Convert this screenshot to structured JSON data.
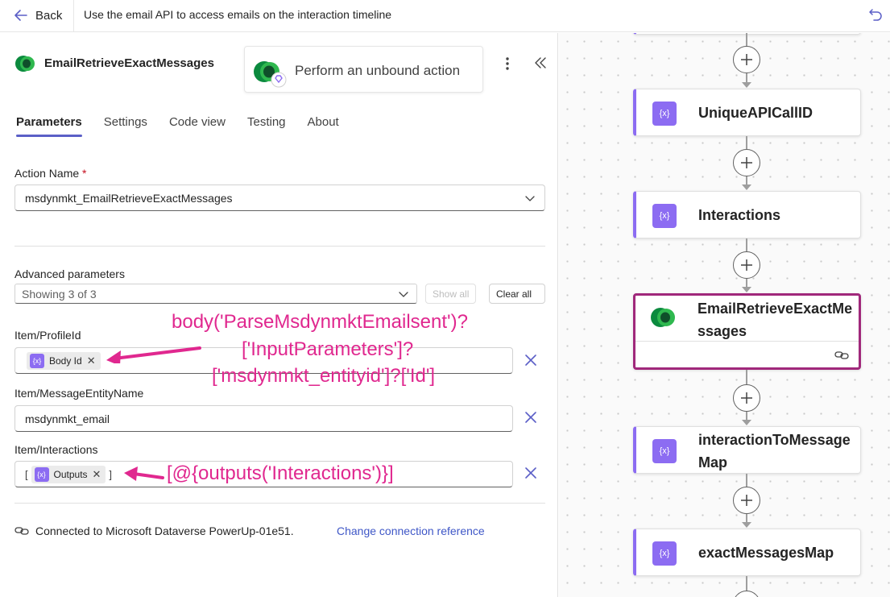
{
  "topbar": {
    "back_label": "Back",
    "title": "Use the email API to access emails on the interaction timeline"
  },
  "panel": {
    "action_title": "EmailRetrieveExactMessages",
    "perform_label": "Perform an unbound action",
    "tabs": [
      {
        "label": "Parameters",
        "active": true
      },
      {
        "label": "Settings",
        "active": false
      },
      {
        "label": "Code view",
        "active": false
      },
      {
        "label": "Testing",
        "active": false
      },
      {
        "label": "About",
        "active": false
      }
    ],
    "action_name_label": "Action Name",
    "action_name_required": "*",
    "action_name_value": "msdynmkt_EmailRetrieveExactMessages",
    "advanced_label": "Advanced parameters",
    "advanced_value": "Showing 3 of 3",
    "show_all_label": "Show all",
    "clear_all_label": "Clear all",
    "profile_label": "Item/ProfileId",
    "profile_token": "Body Id",
    "message_entity_label": "Item/MessageEntityName",
    "message_entity_value": "msdynmkt_email",
    "interactions_label": "Item/Interactions",
    "interactions_open": "[",
    "interactions_token": "Outputs",
    "interactions_close": "]",
    "connected_text": "Connected to Microsoft Dataverse PowerUp-01e51.",
    "change_connection_label": "Change connection reference"
  },
  "annotations": {
    "profile_line1": "body('ParseMsdynmktEmailsent')?",
    "profile_line2": "['InputParameters']?",
    "profile_line3": "['msdynmkt_entityid']?['Id']",
    "interactions_expr": "[@{outputs('Interactions')}]"
  },
  "flow": {
    "cards": [
      {
        "label": "UniqueAPICallID"
      },
      {
        "label": "Interactions"
      },
      {
        "label": "EmailRetrieveExactMessages"
      },
      {
        "label": "interactionToMessageMap"
      },
      {
        "label": "exactMessagesMap"
      }
    ]
  },
  "colors": {
    "accent": "#5b5fc7",
    "token_purple": "#8c6cf2",
    "annotation": "#e0288f",
    "selected_border": "#a0287b"
  }
}
